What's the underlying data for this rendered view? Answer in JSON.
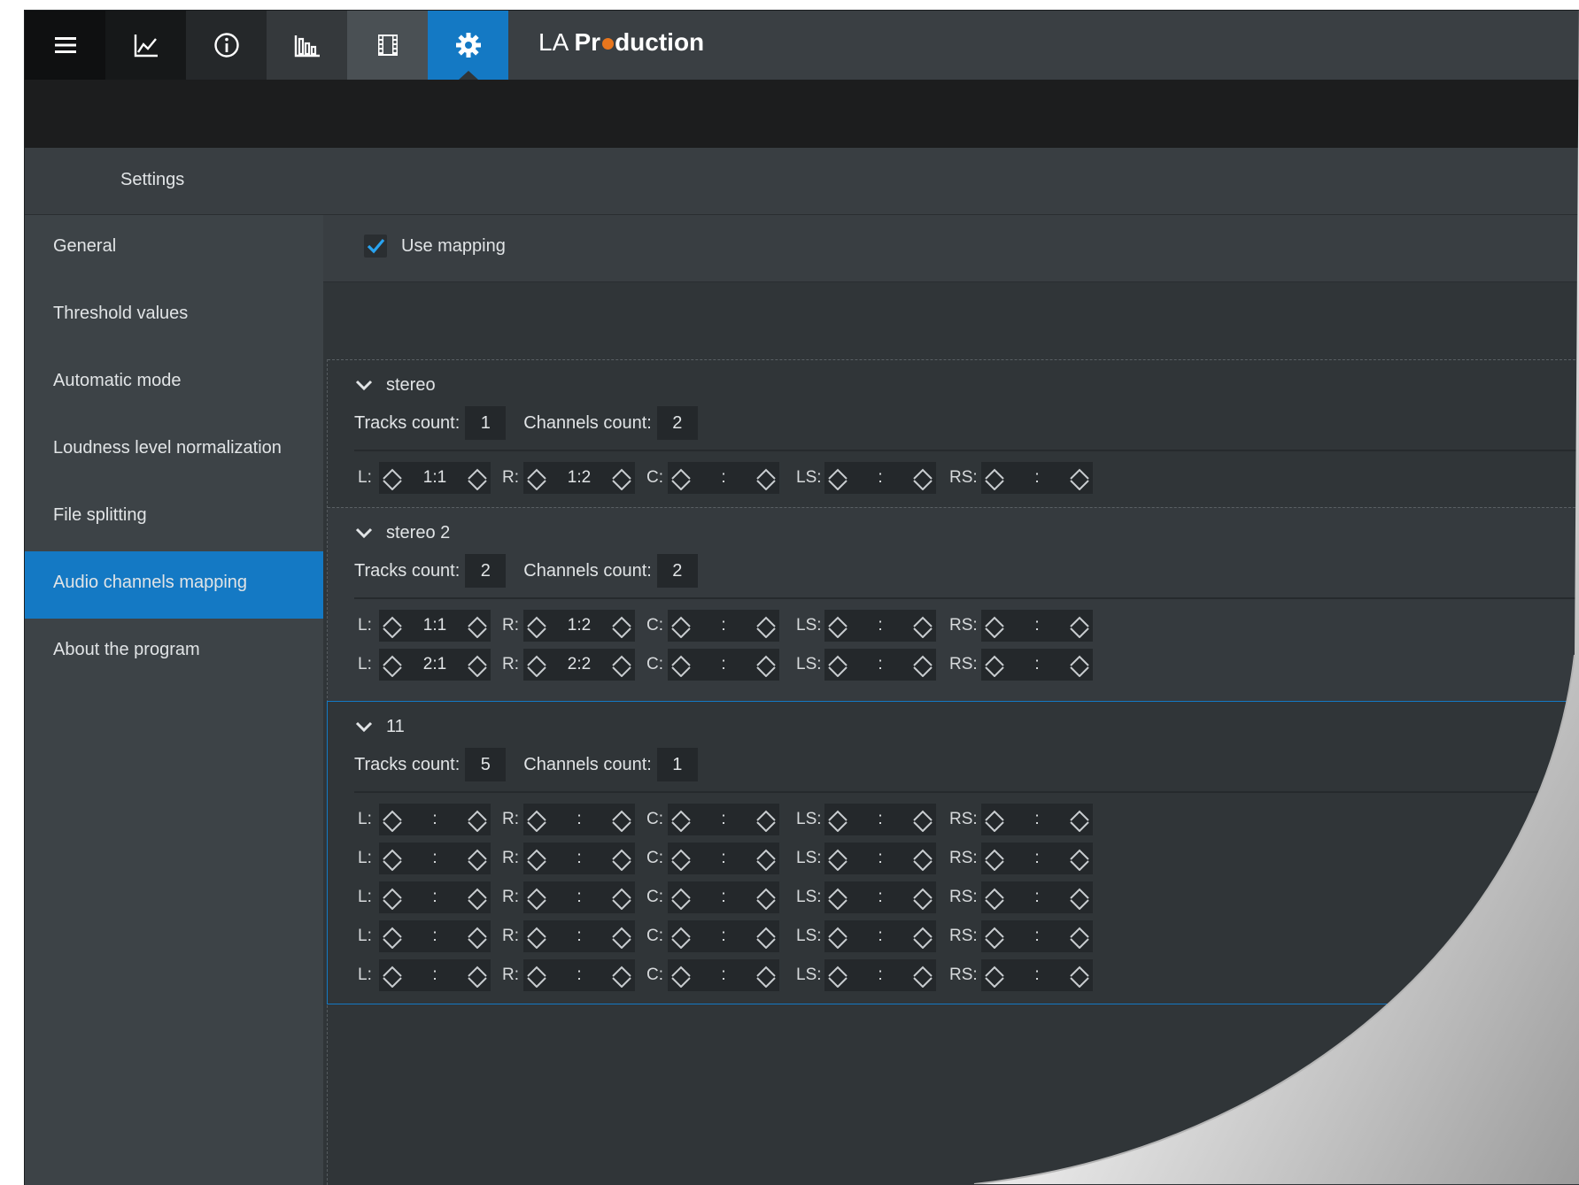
{
  "app": {
    "title_prefix": "LA ",
    "title_p": "Pr",
    "title_rest": "duction"
  },
  "toolbar": [
    {
      "icon": "menu-icon"
    },
    {
      "icon": "line-chart-icon"
    },
    {
      "icon": "info-icon"
    },
    {
      "icon": "bar-chart-icon"
    },
    {
      "icon": "film-icon"
    },
    {
      "icon": "gear-icon"
    }
  ],
  "settings": {
    "title": "Settings"
  },
  "sidebar": {
    "items": [
      {
        "label": "General"
      },
      {
        "label": "Threshold values"
      },
      {
        "label": "Automatic mode"
      },
      {
        "label": "Loudness level normalization"
      },
      {
        "label": "File splitting"
      },
      {
        "label": "Audio channels mapping",
        "active": true
      },
      {
        "label": "About the program"
      }
    ]
  },
  "mapping": {
    "use_mapping_label": "Use mapping",
    "use_mapping_checked": true
  },
  "labels": {
    "tracks_count": "Tracks count:",
    "channels_count": "Channels count:",
    "channels": [
      "L:",
      "R:",
      "C:",
      "LS:",
      "RS:"
    ]
  },
  "groups": [
    {
      "name": "stereo",
      "tracks_count": "1",
      "channels_count": "2",
      "rows": [
        [
          "1:1",
          "1:2",
          ":",
          ":",
          ":"
        ]
      ]
    },
    {
      "name": "stereo 2",
      "tracks_count": "2",
      "channels_count": "2",
      "rows": [
        [
          "1:1",
          "1:2",
          ":",
          ":",
          ":"
        ],
        [
          "2:1",
          "2:2",
          ":",
          ":",
          ":"
        ]
      ]
    },
    {
      "name": "11",
      "tracks_count": "5",
      "channels_count": "1",
      "rows": [
        [
          ":",
          ":",
          ":",
          ":",
          ":"
        ],
        [
          ":",
          ":",
          ":",
          ":",
          ":"
        ],
        [
          ":",
          ":",
          ":",
          ":",
          ":"
        ],
        [
          ":",
          ":",
          ":",
          ":",
          ":"
        ],
        [
          ":",
          ":",
          ":",
          ":",
          ":"
        ]
      ]
    }
  ],
  "colors": {
    "accent": "#1479c4",
    "logo_dot": "#e8761d",
    "background": "#303538",
    "sidebar": "#3d4347"
  }
}
